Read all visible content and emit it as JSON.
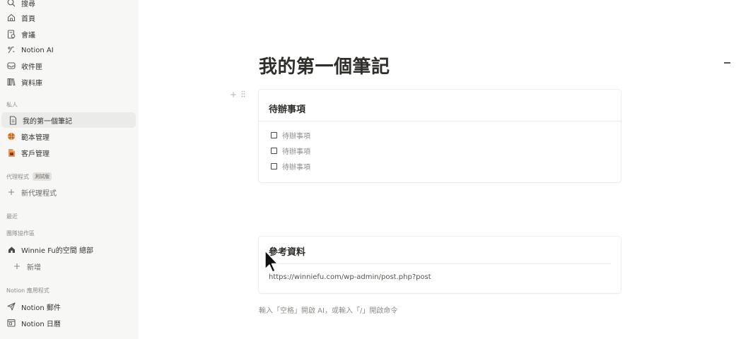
{
  "sidebar": {
    "top_items": [
      {
        "label": "搜尋",
        "icon": "search-icon"
      },
      {
        "label": "首頁",
        "icon": "home-icon"
      },
      {
        "label": "會議",
        "icon": "meeting-notes-icon"
      },
      {
        "label": "Notion AI",
        "icon": "ai-face-icon"
      },
      {
        "label": "收件匣",
        "icon": "inbox-icon"
      },
      {
        "label": "資料庫",
        "icon": "library-icon"
      }
    ],
    "private_label": "私人",
    "private_items": [
      {
        "label": "我的第一個筆記",
        "icon": "page-icon"
      },
      {
        "label": "範本管理",
        "icon": "template-icon"
      },
      {
        "label": "客戶管理",
        "icon": "client-icon"
      }
    ],
    "agents_label": "代理程式",
    "agents_badge": "測試版",
    "new_agent_label": "新代理程式",
    "recent_label": "最近",
    "teamspace_label": "團隊協作區",
    "workspace_item": "Winnie Fu的空間 總部",
    "add_new_label": "新增",
    "apps_label": "Notion 應用程式",
    "app_items": [
      {
        "label": "Notion 郵件",
        "icon": "mail-send-icon"
      },
      {
        "label": "Notion 日曆",
        "icon": "calendar-icon"
      }
    ]
  },
  "page": {
    "title": "我的第一個筆記",
    "todo_card": {
      "title": "待辦事項",
      "items": [
        "待辦事項",
        "待辦事項",
        "待辦事項"
      ]
    },
    "reference_card": {
      "title": "參考資料",
      "link": "https://winniefu.com/wp-admin/post.php?post"
    },
    "hint": "輸入「空格」開啟 AI，或輸入「/」開啟命令"
  }
}
